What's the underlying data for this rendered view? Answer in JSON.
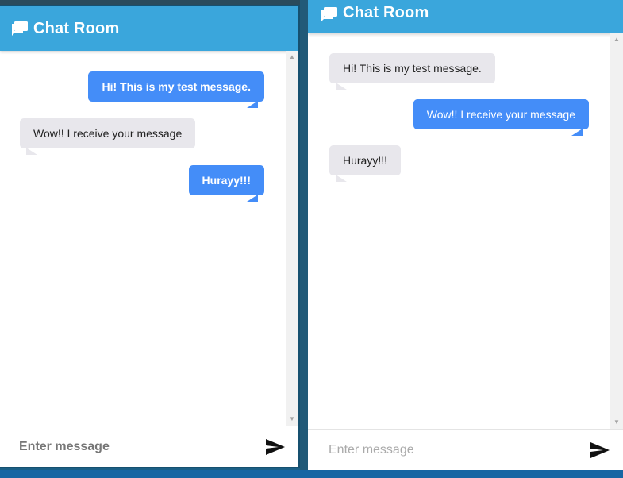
{
  "left_window": {
    "title": "Chat Room",
    "messages": [
      {
        "type": "sent",
        "text": "Hi! This is my test message."
      },
      {
        "type": "received",
        "text": "Wow!! I receive your message"
      },
      {
        "type": "sent",
        "text": "Hurayy!!!"
      }
    ],
    "input": {
      "placeholder": "Enter message",
      "value": ""
    }
  },
  "right_window": {
    "title": "Chat Room",
    "messages": [
      {
        "type": "received",
        "text": "Hi! This is my test message."
      },
      {
        "type": "sent",
        "text": "Wow!! I receive your message"
      },
      {
        "type": "received",
        "text": "Hurayy!!!"
      }
    ],
    "input": {
      "placeholder": "Enter message",
      "value": ""
    }
  },
  "icons": {
    "chat": "chat-bubbles-icon",
    "send": "send-icon",
    "scroll_up": "scroll-up-arrow-icon",
    "scroll_down": "scroll-down-arrow-icon"
  },
  "colors": {
    "header": "#3aa6dc",
    "sent_bubble": "#448df8",
    "received_bubble": "#e8e7ec",
    "desktop": "#1b5f86"
  }
}
